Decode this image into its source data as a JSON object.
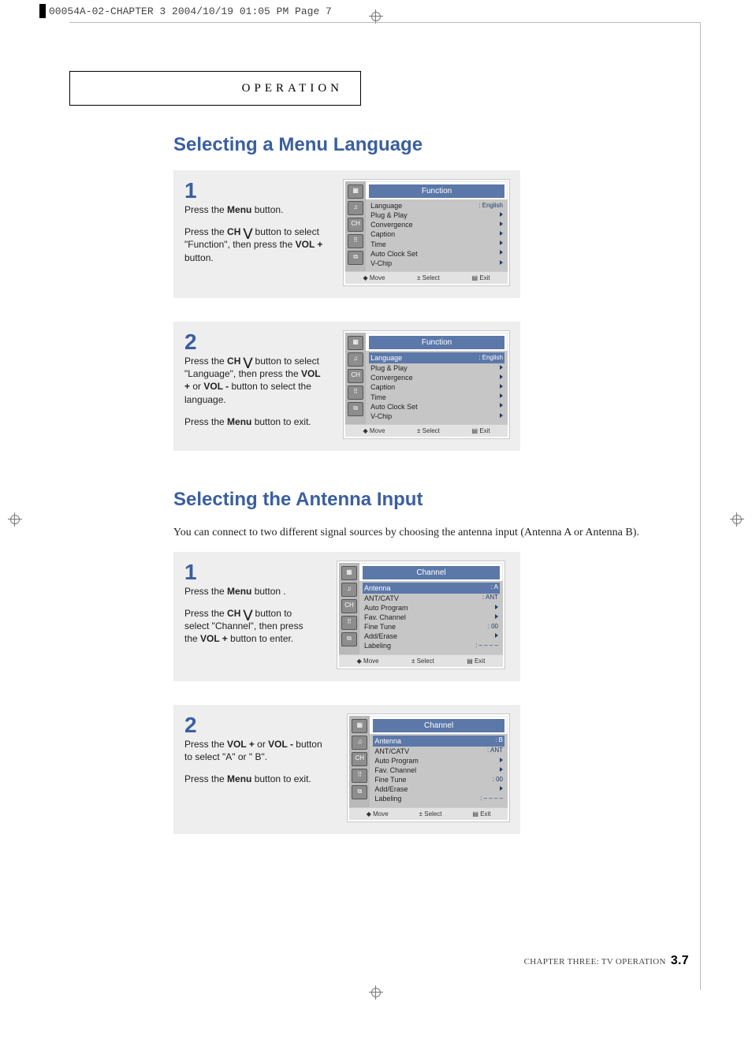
{
  "slug": "00054A-02-CHAPTER 3  2004/10/19  01:05 PM  Page 7",
  "operation_label": "OPERATION",
  "section1_title": "Selecting a Menu Language",
  "section2_title": "Selecting the Antenna Input",
  "section2_intro": "You can connect to two different signal sources by choosing the antenna input (Antenna A or Antenna B).",
  "footer": {
    "chapter_text": "CHAPTER THREE: TV OPERATION",
    "page_num": "3.7"
  },
  "osd_footer": {
    "move": "Move",
    "select": "Select",
    "exit": "Exit"
  },
  "osd_function_title": "Function",
  "osd_channel_title": "Channel",
  "osd_function_items": [
    {
      "label": "Language",
      "value": ": English"
    },
    {
      "label": "Plug & Play",
      "value": ""
    },
    {
      "label": "Convergence",
      "value": ""
    },
    {
      "label": "Caption",
      "value": ""
    },
    {
      "label": "Time",
      "value": ""
    },
    {
      "label": "Auto Clock Set",
      "value": ""
    },
    {
      "label": "V-Chip",
      "value": ""
    }
  ],
  "osd_channel_items_a": [
    {
      "label": "Antenna",
      "value": ": A"
    },
    {
      "label": "ANT/CATV",
      "value": ": ANT"
    },
    {
      "label": "Auto Program",
      "value": ""
    },
    {
      "label": "Fav. Channel",
      "value": ""
    },
    {
      "label": "Fine Tune",
      "value": ":  00"
    },
    {
      "label": "Add/Erase",
      "value": ""
    },
    {
      "label": "Labeling",
      "value": ": – – – –"
    }
  ],
  "osd_channel_items_b": [
    {
      "label": "Antenna",
      "value": ": B"
    },
    {
      "label": "ANT/CATV",
      "value": ": ANT"
    },
    {
      "label": "Auto Program",
      "value": ""
    },
    {
      "label": "Fav. Channel",
      "value": ""
    },
    {
      "label": "Fine Tune",
      "value": ":  00"
    },
    {
      "label": "Add/Erase",
      "value": ""
    },
    {
      "label": "Labeling",
      "value": ": – – – –"
    }
  ],
  "steps_lang": {
    "s1": {
      "num": "1",
      "l1a": "Press the ",
      "l1b": "Menu",
      "l1c": " button.",
      "l2a": "Press the ",
      "l2b": "CH ",
      "l2c": " button to select \"Function\", then press the ",
      "l2d": "VOL +",
      "l2e": " button."
    },
    "s2": {
      "num": "2",
      "l1a": "Press the ",
      "l1b": "CH ",
      "l1c": " button to select \"Language\", then press the ",
      "l1d": "VOL +",
      "l1e": " or ",
      "l1f": "VOL -",
      "l1g": " button to select the language.",
      "l2a": "Press the ",
      "l2b": "Menu",
      "l2c": " button to exit."
    }
  },
  "steps_ant": {
    "s1": {
      "num": "1",
      "l1a": "Press the ",
      "l1b": "Menu",
      "l1c": " button .",
      "l2a": "Press the ",
      "l2b": "CH ",
      "l2c": " button to select \"Channel\", then press the ",
      "l2d": "VOL +",
      "l2e": " button to enter."
    },
    "s2": {
      "num": "2",
      "l1a": "Press the ",
      "l1b": "VOL +",
      "l1c": " or  ",
      "l1d": "VOL -",
      "l1e": " button to select  \"A\" or \" B\".",
      "l2a": "Press the ",
      "l2b": "Menu",
      "l2c": " button to exit."
    }
  }
}
